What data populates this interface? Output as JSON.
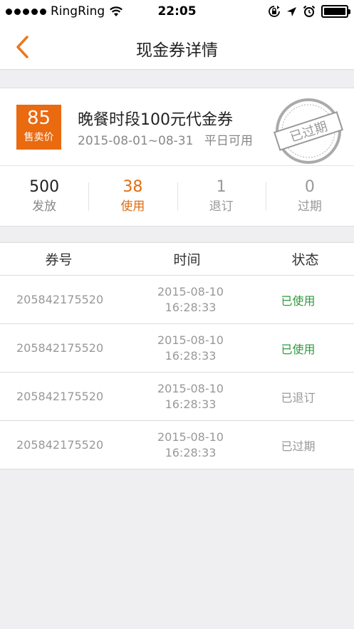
{
  "status_bar": {
    "carrier": "RingRing",
    "time": "22:05"
  },
  "nav": {
    "title": "现金券详情"
  },
  "coupon": {
    "price": "85",
    "price_label": "售卖价",
    "name": "晚餐时段100元代金券",
    "date_range": "2015-08-01~08-31",
    "usage_note": "平日可用",
    "stamp_text": "已过期",
    "accent_color": "#ea6a10"
  },
  "stats": [
    {
      "value": "500",
      "label": "发放"
    },
    {
      "value": "38",
      "label": "使用"
    },
    {
      "value": "1",
      "label": "退订"
    },
    {
      "value": "0",
      "label": "过期"
    }
  ],
  "table": {
    "headers": [
      "券号",
      "时间",
      "状态"
    ],
    "rows": [
      {
        "code": "205842175520",
        "date": "2015-08-10",
        "time": "16:28:33",
        "status": "已使用"
      },
      {
        "code": "205842175520",
        "date": "2015-08-10",
        "time": "16:28:33",
        "status": "已使用"
      },
      {
        "code": "205842175520",
        "date": "2015-08-10",
        "time": "16:28:33",
        "status": "已退订"
      },
      {
        "code": "205842175520",
        "date": "2015-08-10",
        "time": "16:28:33",
        "status": "已过期"
      }
    ]
  }
}
